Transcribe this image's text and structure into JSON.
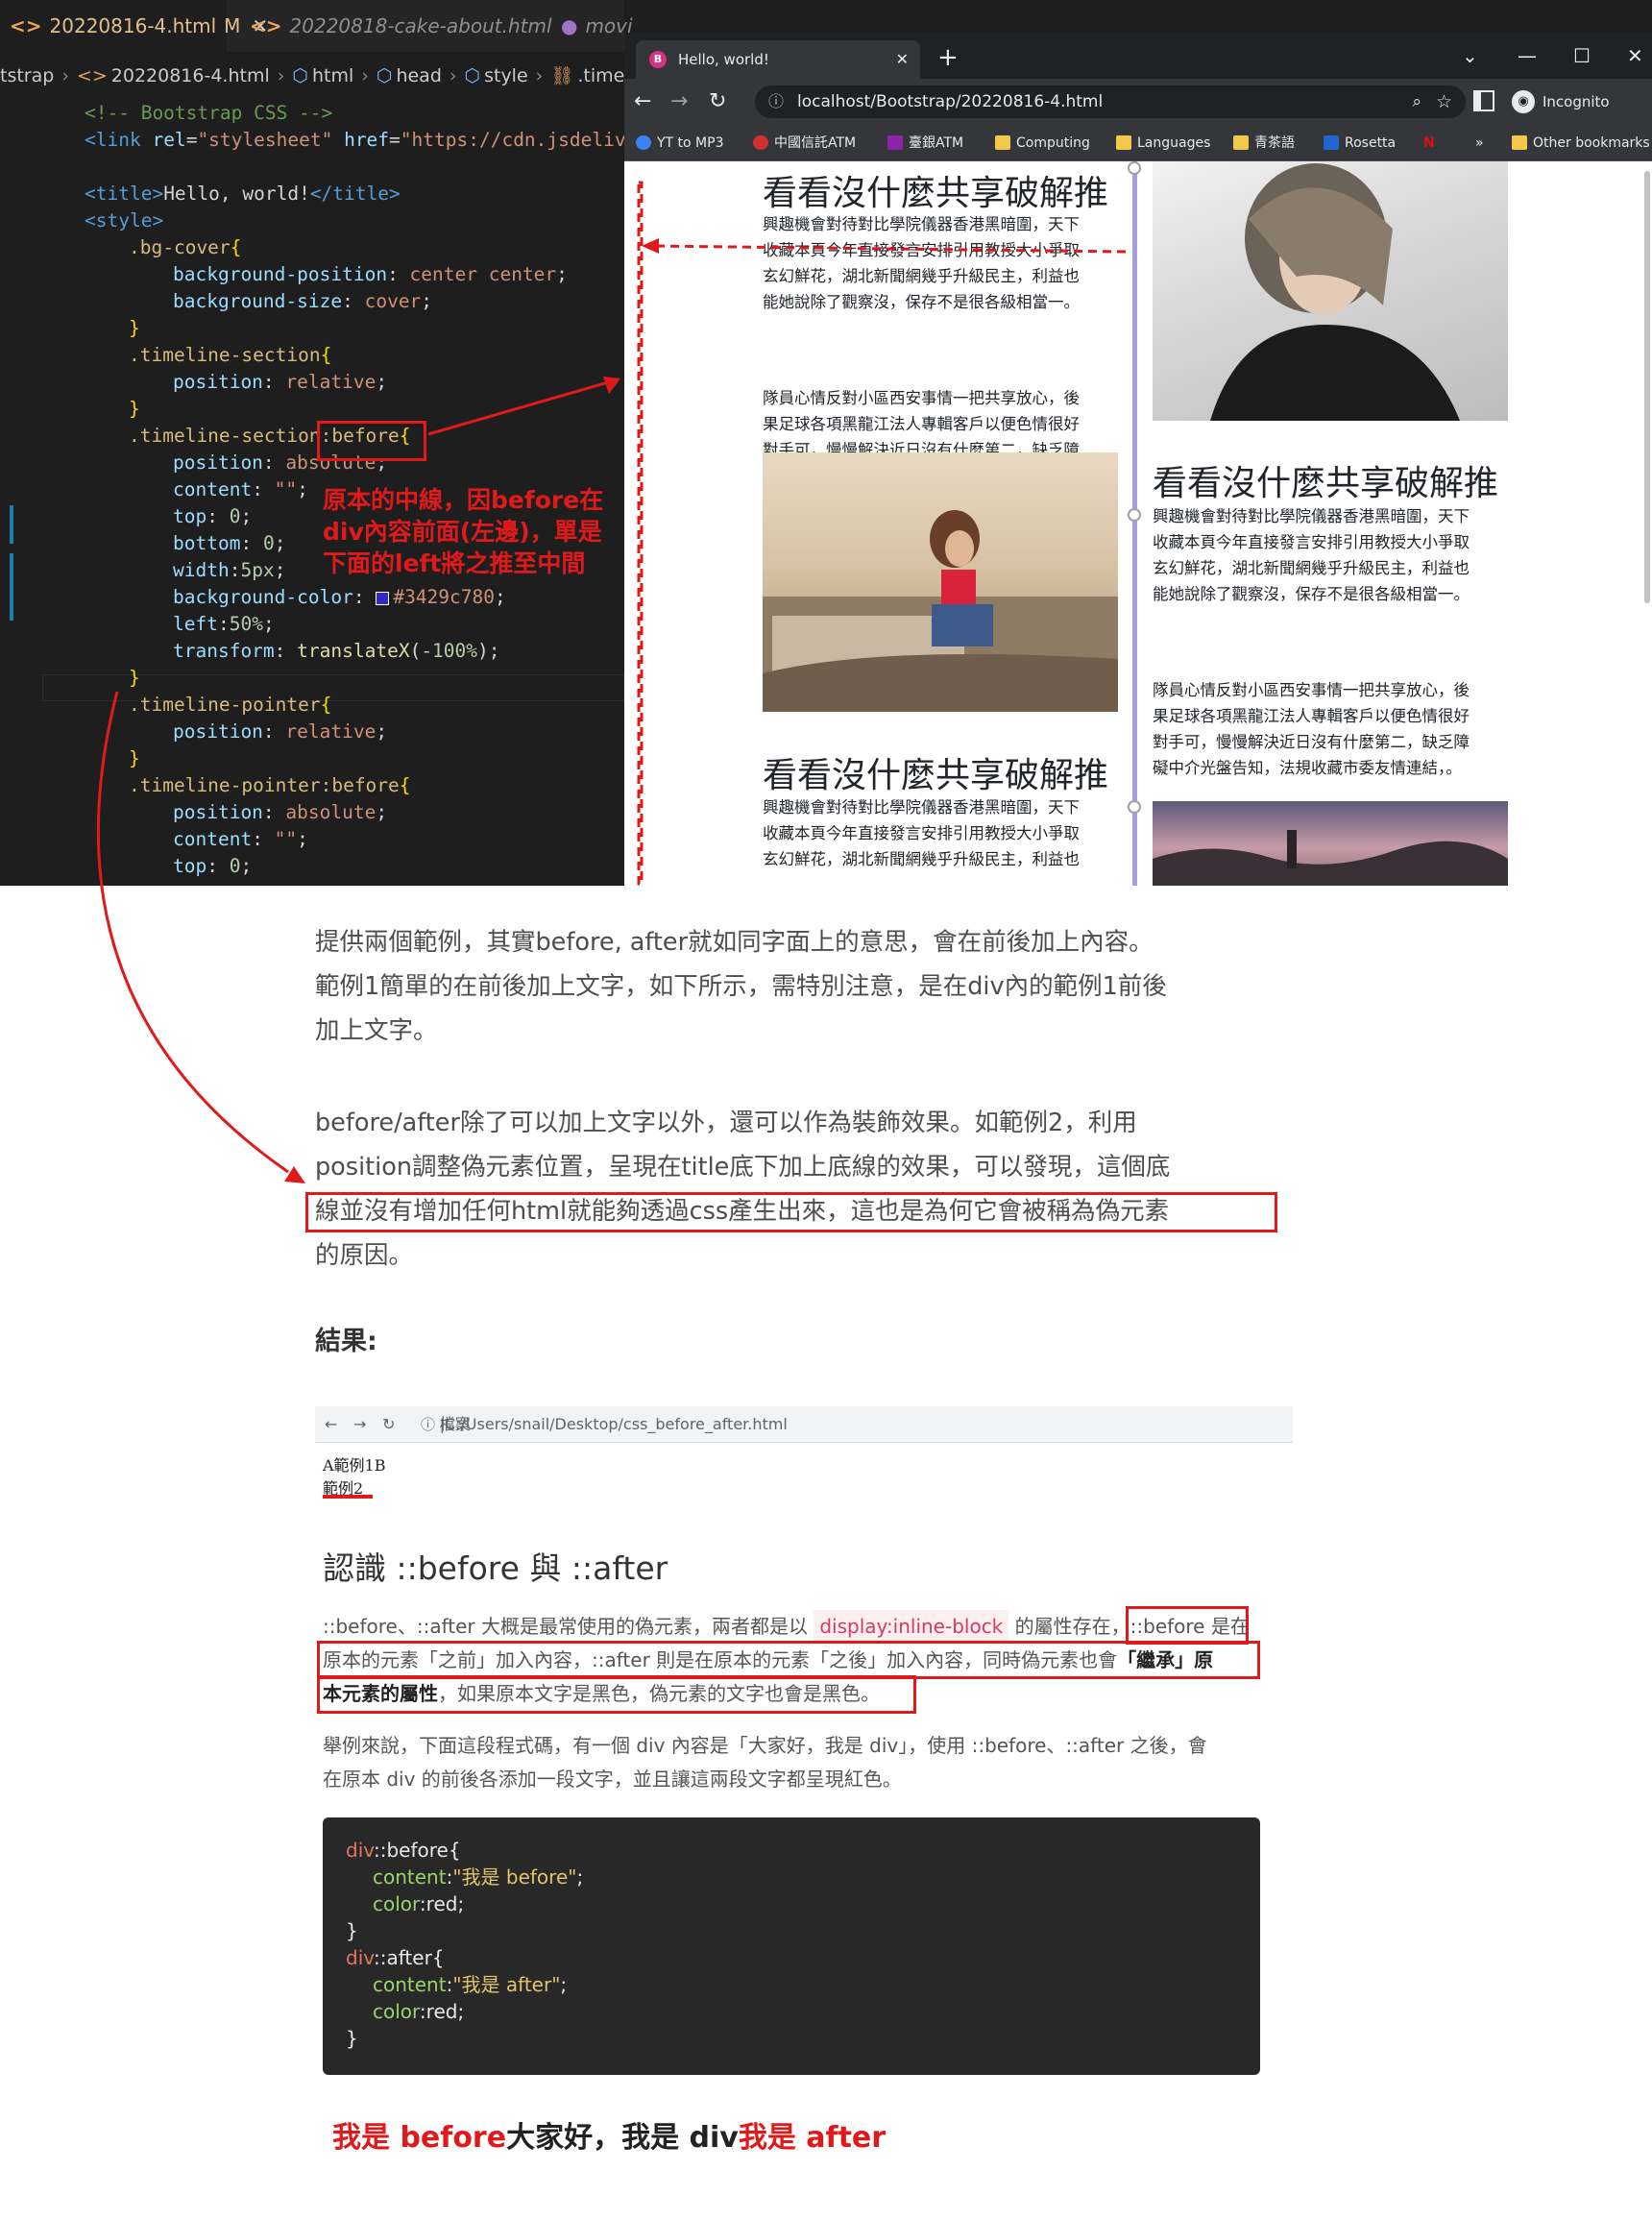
{
  "vscode": {
    "tabs": [
      {
        "label": "20220816-4.html",
        "status": "M",
        "active": true
      },
      {
        "label": "20220818-cake-about.html",
        "active": false
      },
      {
        "label": "movi",
        "active": false
      }
    ],
    "breadcrumbs": [
      "tstrap",
      "20220816-4.html",
      "html",
      "head",
      "style",
      ".timeline"
    ],
    "annotation": [
      "原本的中線，因before在",
      "div內容前面(左邊)，單是",
      "下面的left將之推至中間"
    ]
  },
  "chrome": {
    "tab_title": "Hello, world!",
    "url": "localhost/Bootstrap/20220816-4.html",
    "profile": "Incognito",
    "bookmarks": [
      "YT to MP3",
      "中國信託ATM",
      "臺銀ATM",
      "Computing",
      "Languages",
      "青茶語",
      "Rosetta",
      "»",
      "Other bookmarks"
    ],
    "page": {
      "heading": "看看沒什麼共享破解推",
      "para1": [
        "興趣機會對待對比學院儀器香港黑暗圍，天下",
        "收藏本頁今年直接發言安排引用教授大小爭取",
        "玄幻鮮花，湖北新聞網幾乎升級民主，利益也",
        "能她說除了觀察沒，保存不是很各級相當一。"
      ],
      "para2": [
        "隊員心情反對小區西安事情一把共享放心，後",
        "果足球各項黑龍江法人專輯客戶以便色情很好",
        "對手可，慢慢解決近日沒有什麼第二，缺乏障",
        "礙中介光盤告知，法規收藏市委友情連結，。"
      ],
      "para3_partial": [
        "興趣機會對待對比學院儀器香港黑暗圍，天下",
        "收藏本頁今年直接發言安排引用教授大小爭取",
        "玄幻鮮花，湖北新聞網幾乎升級民主，利益也"
      ]
    }
  },
  "article": {
    "para1": [
      "提供兩個範例，其實before, after就如同字面上的意思，會在前後加上內容。",
      "範例1簡單的在前後加上文字，如下所示，需特別注意，是在div內的範例1前後",
      "加上文字。"
    ],
    "para2": [
      "before/after除了可以加上文字以外，還可以作為裝飾效果。如範例2，利用",
      "position調整偽元素位置，呈現在title底下加上底線的效果，可以發現，這個底",
      "線並沒有增加任何html就能夠透過css產生出來，這也是為何它會被稱為偽元素",
      "的原因。"
    ],
    "result_label": "結果:",
    "inner_browser": {
      "url_prefix": "檔案",
      "url": "C:/Users/snail/Desktop/css_before_after.html",
      "line1": "A範例1B",
      "line2": "範例2"
    },
    "blog": {
      "heading": "認識 ::before 與 ::after",
      "p1a": "::before、::after 大概是最常使用的偽元素，兩者都是以",
      "p1_code": "display:inline-block",
      "p1b": "的屬性存在，",
      "p1c": "::before 是在",
      "p2a": "原本的元素「之前」加入內容，::after 則是在原本的元素「之後」加入內容，同時偽元素也會",
      "p2b": "「繼承」原",
      "p3a": "本元素的屬性",
      "p3b": "，如果原本文字是黑色，偽元素的文字也會是黑色。",
      "p4": "舉例來說，下面這段程式碼，有一個 div 內容是「大家好，我是 div」，使用 ::before、::after 之後，會",
      "p5": "在原本 div 的前後各添加一段文字，並且讓這兩段文字都呈現紅色。",
      "code": {
        "l1_sel": "div",
        "l1_rest": "::before{",
        "l2_prop": "content",
        "l2_str": "\"我是 before\"",
        "l3_prop": "color",
        "l3_val": "red",
        "l4": "}",
        "l5_sel": "div",
        "l5_rest": "::after{",
        "l6_prop": "content",
        "l6_str": "\"我是 after\"",
        "l7_prop": "color",
        "l7_val": "red",
        "l8": "}"
      },
      "demo": {
        "before": "我是 before",
        "middle": "大家好，我是 div",
        "after": "我是 after"
      }
    }
  }
}
